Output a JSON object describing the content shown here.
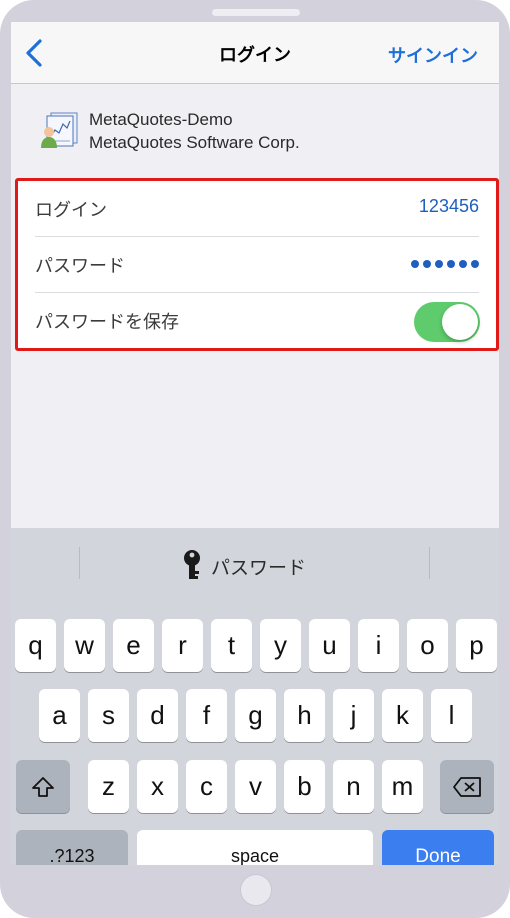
{
  "navbar": {
    "title": "ログイン",
    "action": "サインイン"
  },
  "server": {
    "name": "MetaQuotes-Demo",
    "company": "MetaQuotes Software Corp."
  },
  "form": {
    "login_label": "ログイン",
    "login_value": "123456",
    "password_label": "パスワード",
    "password_dot_count": 6,
    "save_password_label": "パスワードを保存",
    "save_password_enabled": true
  },
  "keyboard": {
    "suggestion": "パスワード",
    "row1": [
      "q",
      "w",
      "e",
      "r",
      "t",
      "y",
      "u",
      "i",
      "o",
      "p"
    ],
    "row2": [
      "a",
      "s",
      "d",
      "f",
      "g",
      "h",
      "j",
      "k",
      "l"
    ],
    "row3": [
      "z",
      "x",
      "c",
      "v",
      "b",
      "n",
      "m"
    ],
    "numbers_key": ".?123",
    "space_key": "space",
    "done_key": "Done"
  },
  "colors": {
    "accent": "#1e6fd8",
    "toggle_on": "#5ecb6c",
    "highlight_border": "#e01919",
    "done": "#3a7ef0"
  },
  "icons": [
    "back-chevron-icon",
    "server-icon",
    "key-icon",
    "shift-icon",
    "delete-icon"
  ]
}
